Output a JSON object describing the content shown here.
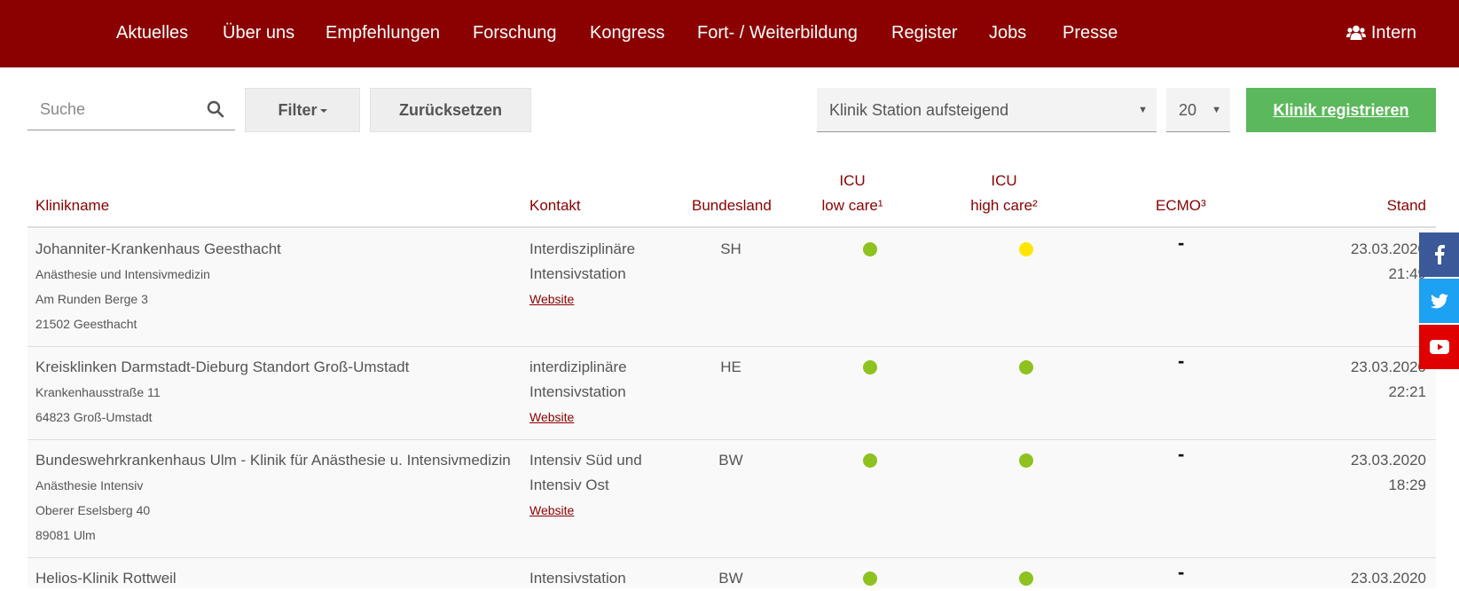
{
  "nav": {
    "items": [
      "Aktuelles",
      "Über uns",
      "Empfehlungen",
      "Forschung",
      "Kongress",
      "Fort- / Weiterbildung",
      "Register",
      "Jobs",
      "Presse"
    ],
    "intern_label": "Intern",
    "intern_icon": "users-icon",
    "bg_color": "#8b0000"
  },
  "toolbar": {
    "search_placeholder": "Suche",
    "filter_label": "Filter",
    "reset_label": "Zurücksetzen",
    "sort_value": "Klinik Station aufsteigend",
    "per_page_value": "20",
    "register_label": "Klinik registrieren",
    "register_color": "#5cb85c"
  },
  "table": {
    "headers": {
      "klinikname": "Klinikname",
      "kontakt": "Kontakt",
      "bundesland": "Bundesland",
      "icu_low_1": "ICU",
      "icu_low_2": "low care¹",
      "icu_high_1": "ICU",
      "icu_high_2": "high care²",
      "ecmo": "ECMO³",
      "stand": "Stand"
    },
    "rows": [
      {
        "name": "Johanniter-Krankenhaus Geesthacht",
        "lines": [
          "Anästhesie und Intensivmedizin",
          "Am Runden Berge 3",
          "21502 Geesthacht"
        ],
        "kontakt": [
          "Interdisziplinäre",
          "Intensivstation"
        ],
        "website": "Website",
        "bundesland": "SH",
        "icu_low": "green",
        "icu_high": "yellow",
        "ecmo": "-",
        "date": "23.03.2020",
        "time": "21:49"
      },
      {
        "name": "Kreisklinken Darmstadt-Dieburg Standort Groß-Umstadt",
        "lines": [
          "Krankenhausstraße 11",
          "64823 Groß-Umstadt"
        ],
        "kontakt": [
          "interdiziplinäre",
          "Intensivstation"
        ],
        "website": "Website",
        "bundesland": "HE",
        "icu_low": "green",
        "icu_high": "green",
        "ecmo": "-",
        "date": "23.03.2020",
        "time": "22:21"
      },
      {
        "name": "Bundeswehrkrankenhaus Ulm - Klinik für Anästhesie u. Intensivmedizin",
        "lines": [
          "Anästhesie Intensiv",
          "Oberer Eselsberg 40",
          "89081 Ulm"
        ],
        "kontakt": [
          "Intensiv Süd und",
          "Intensiv Ost"
        ],
        "website": "Website",
        "bundesland": "BW",
        "icu_low": "green",
        "icu_high": "green",
        "ecmo": "-",
        "date": "23.03.2020",
        "time": "18:29"
      },
      {
        "name": "Helios-Klinik Rottweil",
        "lines": [],
        "kontakt": [
          "Intensivstation"
        ],
        "website": "",
        "bundesland": "BW",
        "icu_low": "green",
        "icu_high": "green",
        "ecmo": "-",
        "date": "23.03.2020",
        "time": ""
      }
    ],
    "status_colors": {
      "green": "#8dc21f",
      "yellow": "#ffe600"
    }
  },
  "social": [
    {
      "name": "facebook",
      "icon": "facebook-icon",
      "color": "#3b5998"
    },
    {
      "name": "twitter",
      "icon": "twitter-icon",
      "color": "#1da1f2"
    },
    {
      "name": "youtube",
      "icon": "youtube-icon",
      "color": "#e00000"
    }
  ]
}
